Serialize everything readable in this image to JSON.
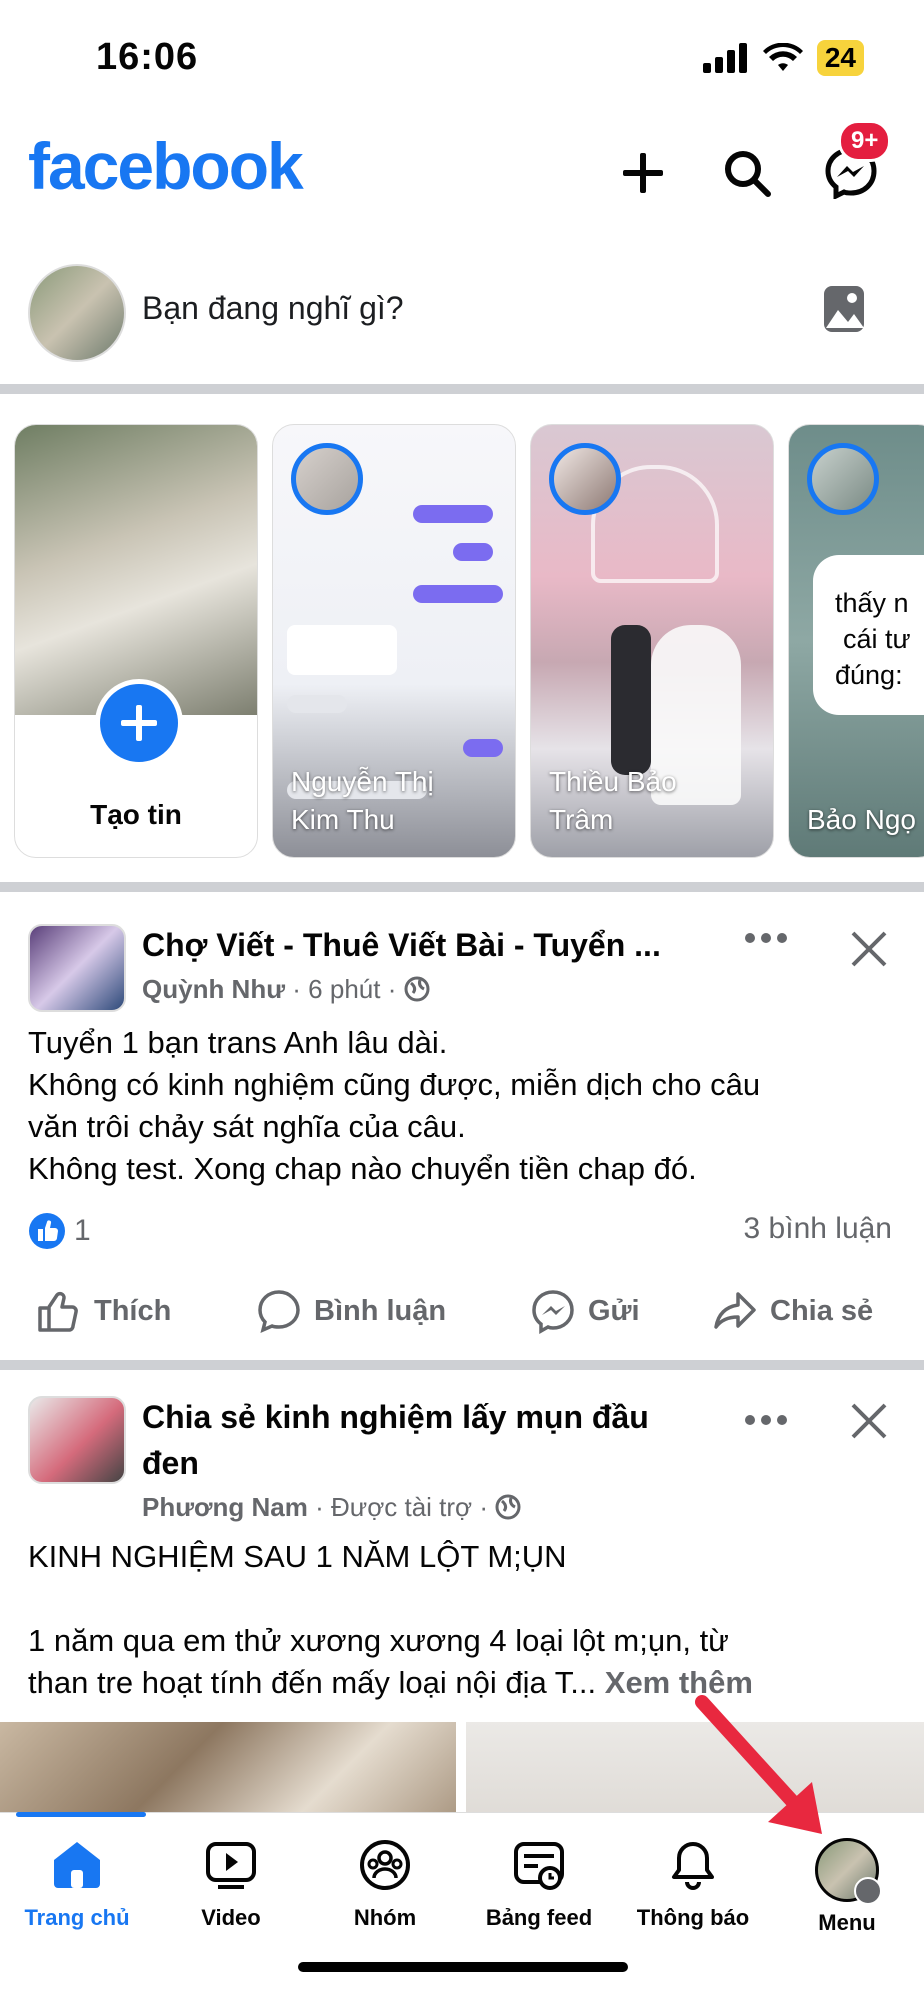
{
  "status": {
    "time": "16:06",
    "battery": "24"
  },
  "header": {
    "logo": "facebook",
    "messenger_badge": "9+"
  },
  "composer": {
    "placeholder": "Bạn đang nghĩ gì?"
  },
  "stories": [
    {
      "label": "Tạo tin"
    },
    {
      "name_line1": "Nguyễn Thị",
      "name_line2": "Kim Thu"
    },
    {
      "name_line1": "Thiều Bảo",
      "name_line2": "Trâm"
    },
    {
      "name_line1": "Bảo Ngọ",
      "bubble_line1": "thấy n",
      "bubble_line2": "cái tư",
      "bubble_line3": "đúng:"
    }
  ],
  "post1": {
    "title": "Chợ Viết - Thuê Viết Bài - Tuyển ...",
    "author": "Quỳnh Như",
    "time": "6 phút",
    "body": [
      "Tuyển 1 bạn trans Anh lâu dài.",
      "Không có kinh nghiệm cũng được, miễn dịch cho câu",
      "văn trôi chảy sát nghĩa của câu.",
      "Không test. Xong chap nào chuyển tiền chap đó."
    ],
    "likes": "1",
    "comments": "3 bình luận",
    "actions": {
      "like": "Thích",
      "comment": "Bình luận",
      "send": "Gửi",
      "share": "Chia sẻ"
    }
  },
  "post2": {
    "title_line1": "Chia sẻ kinh nghiệm lấy mụn đầu",
    "title_line2": "đen",
    "author": "Phương Nam",
    "sponsored": "Được tài trợ",
    "body_line1": "KINH NGHIỆM SAU 1 NĂM LỘT M;ỤN",
    "body_line2": "1 năm qua em thử xương xương 4 loại lột m;ụn, từ",
    "body_line3": "than tre hoạt tính đến mấy loại nội địa T...",
    "see_more": "Xem thêm"
  },
  "nav": [
    {
      "label": "Trang chủ",
      "icon": "home-icon"
    },
    {
      "label": "Video",
      "icon": "video-icon"
    },
    {
      "label": "Nhóm",
      "icon": "groups-icon"
    },
    {
      "label": "Bảng feed",
      "icon": "feed-icon"
    },
    {
      "label": "Thông báo",
      "icon": "bell-icon"
    },
    {
      "label": "Menu",
      "icon": "menu-avatar"
    }
  ],
  "colors": {
    "brand": "#1877f2",
    "badge": "#e41e3f",
    "arrow": "#e8283f"
  }
}
